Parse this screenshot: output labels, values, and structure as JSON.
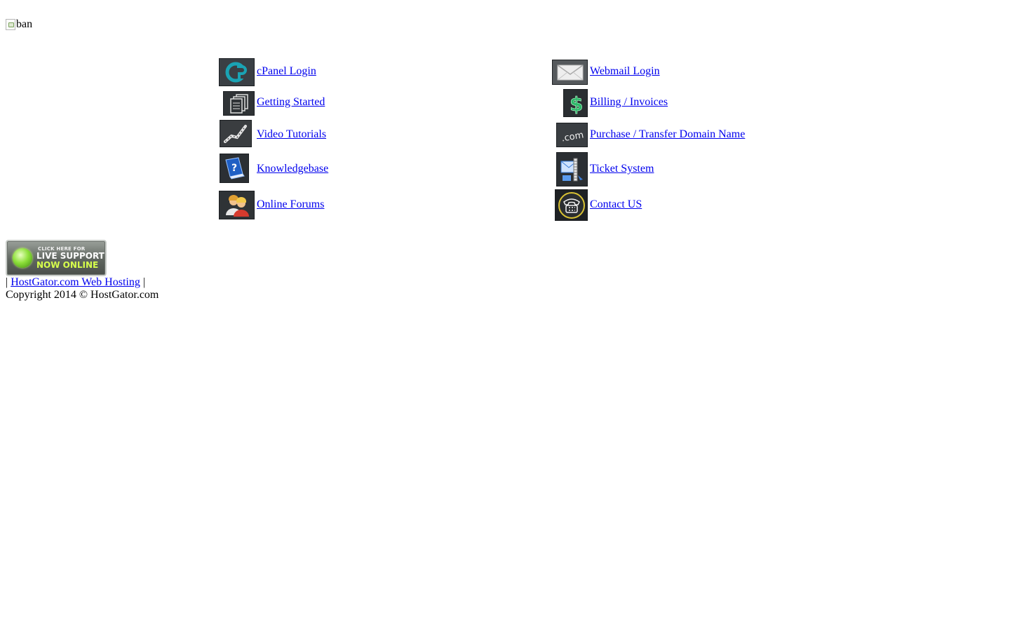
{
  "banner": {
    "alt": "ban"
  },
  "links": {
    "left": [
      {
        "label": "cPanel Login"
      },
      {
        "label": "Getting Started"
      },
      {
        "label": "Video Tutorials"
      },
      {
        "label": "Knowledgebase"
      },
      {
        "label": "Online Forums"
      }
    ],
    "right": [
      {
        "label": "Webmail Login"
      },
      {
        "label": "Billing / Invoices"
      },
      {
        "label": "Purchase / Transfer Domain Name"
      },
      {
        "label": "Ticket System"
      },
      {
        "label": "Contact US"
      }
    ]
  },
  "live_support": {
    "line1": "CLICK HERE FOR",
    "line2": "LIVE SUPPORT",
    "line3": "NOW ONLINE"
  },
  "footer": {
    "sep_left": "|",
    "link": "HostGator.com Web Hosting",
    "sep_right": "|",
    "copyright": "Copyright 2014 © HostGator.com"
  },
  "icons": {
    "cpanel": "cpanel-icon",
    "webmail": "envelope-icon",
    "getting_started": "documents-icon",
    "billing": "dollar-icon",
    "video": "film-strip-icon",
    "domain": "dot-com-icon",
    "knowledgebase": "help-book-icon",
    "ticket": "ticket-mail-icon",
    "forums": "users-icon",
    "contact": "telephone-icon"
  },
  "colors": {
    "link": "#0000ee",
    "icon_bg": "#2f3336",
    "live_green": "#8ee03b"
  }
}
